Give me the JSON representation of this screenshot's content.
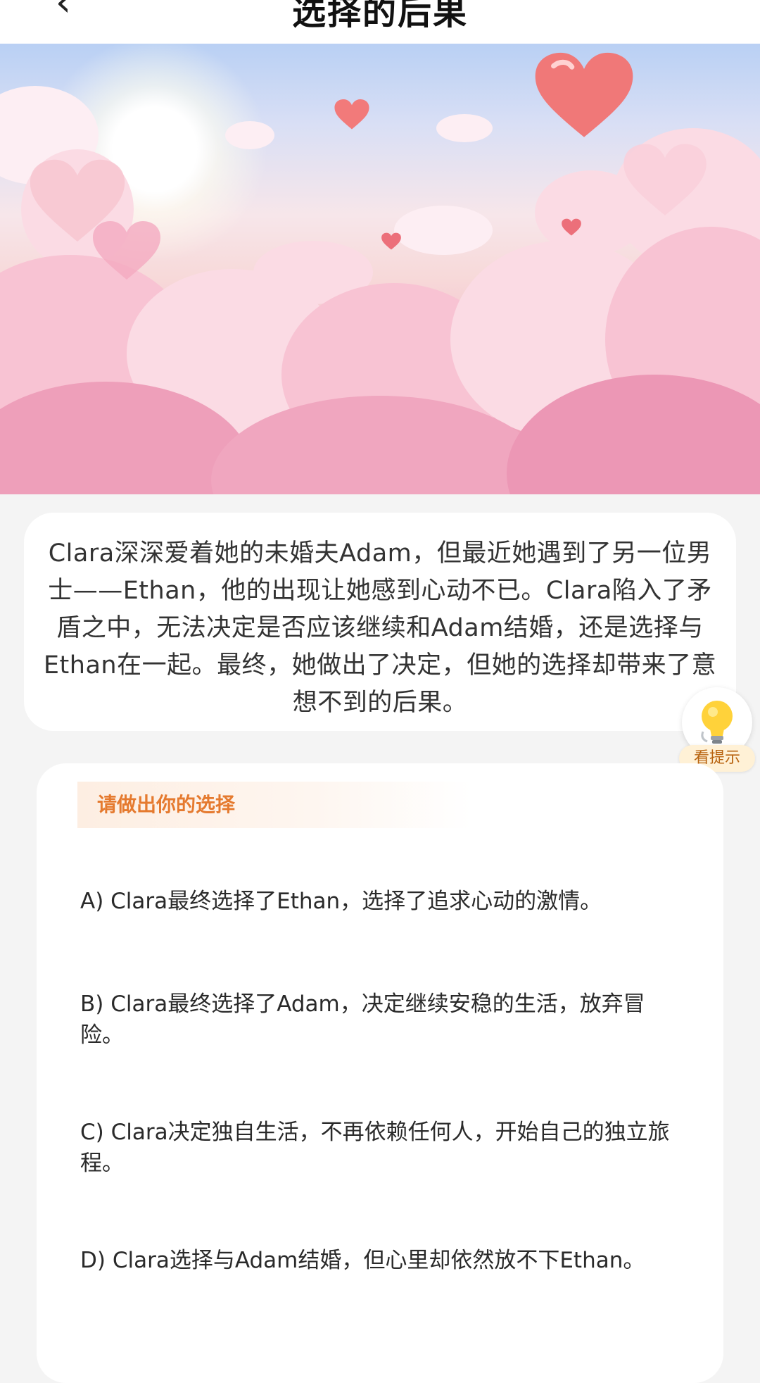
{
  "header": {
    "title": "选择的后果"
  },
  "hero": {
    "colors": {
      "sky_top": "#b9d0f4",
      "cloud_pink": "#f3b3c6",
      "heart_red": "#f07878"
    }
  },
  "story": {
    "text": "Clara深深爱着她的未婚夫Adam，但最近她遇到了另一位男士——Ethan，他的出现让她感到心动不已。Clara陷入了矛盾之中，无法决定是否应该继续和Adam结婚，还是选择与Ethan在一起。最终，她做出了决定，但她的选择却带来了意想不到的后果。"
  },
  "hint": {
    "label": "看提示",
    "icon": "lightbulb-icon"
  },
  "choices": {
    "prompt": "请做出你的选择",
    "accent_color": "#e57a2f",
    "options": [
      {
        "label": "A) Clara最终选择了Ethan，选择了追求心动的激情。"
      },
      {
        "label": "B) Clara最终选择了Adam，决定继续安稳的生活，放弃冒险。"
      },
      {
        "label": "C) Clara决定独自生活，不再依赖任何人，开始自己的独立旅程。"
      },
      {
        "label": "D) Clara选择与Adam结婚，但心里却依然放不下Ethan。"
      }
    ]
  }
}
